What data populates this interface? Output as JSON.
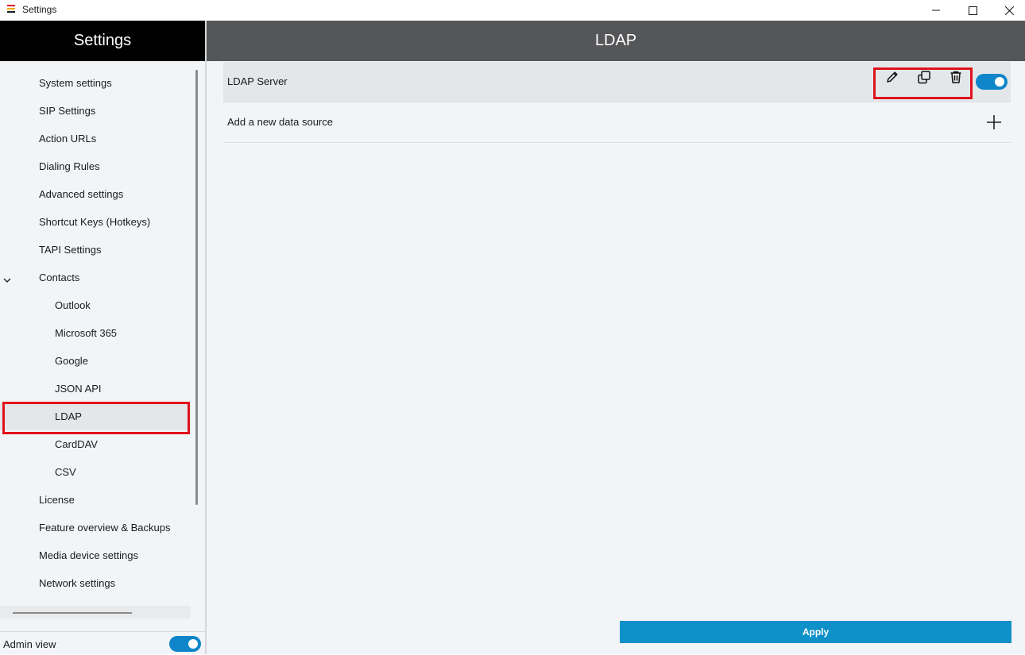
{
  "window": {
    "title": "Settings",
    "brand_colors": [
      "#e0121b",
      "#f2a900",
      "#1a1a1a"
    ]
  },
  "sidebar": {
    "header": "Settings",
    "items": [
      {
        "label": "System settings",
        "level": 0
      },
      {
        "label": "SIP Settings",
        "level": 0
      },
      {
        "label": "Action URLs",
        "level": 0
      },
      {
        "label": "Dialing Rules",
        "level": 0
      },
      {
        "label": "Advanced settings",
        "level": 0
      },
      {
        "label": "Shortcut Keys (Hotkeys)",
        "level": 0
      },
      {
        "label": "TAPI Settings",
        "level": 0
      },
      {
        "label": "Contacts",
        "level": 0,
        "expanded": true
      },
      {
        "label": "Outlook",
        "level": 1
      },
      {
        "label": "Microsoft 365",
        "level": 1
      },
      {
        "label": "Google",
        "level": 1
      },
      {
        "label": "JSON API",
        "level": 1
      },
      {
        "label": "LDAP",
        "level": 1,
        "selected": true
      },
      {
        "label": "CardDAV",
        "level": 1
      },
      {
        "label": "CSV",
        "level": 1
      },
      {
        "label": "License",
        "level": 0
      },
      {
        "label": "Feature overview & Backups",
        "level": 0
      },
      {
        "label": "Media device settings",
        "level": 0
      },
      {
        "label": "Network settings",
        "level": 0
      }
    ],
    "admin_view": {
      "label": "Admin view",
      "enabled": true
    }
  },
  "main": {
    "title": "LDAP",
    "sources": [
      {
        "name": "LDAP Server",
        "enabled": true,
        "actions": [
          "edit-icon",
          "duplicate-icon",
          "delete-icon"
        ]
      }
    ],
    "add_label": "Add a new data source",
    "apply_label": "Apply"
  },
  "colors": {
    "accent": "#0e86c9",
    "highlight": "#e0121b",
    "sidebar_header": "#000000",
    "main_header": "#555658"
  }
}
